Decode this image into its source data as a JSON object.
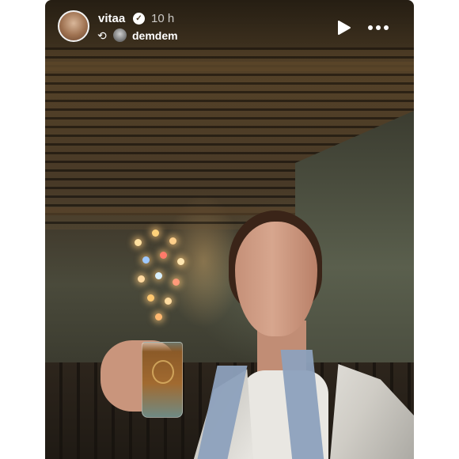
{
  "story": {
    "username": "vitaa",
    "verified_badge": "✓",
    "time_ago": "10 h",
    "repost_icon": "⟲",
    "reposted_from": "demdem"
  },
  "controls": {
    "play_icon": "play-icon",
    "more_icon": "more-options-icon"
  }
}
